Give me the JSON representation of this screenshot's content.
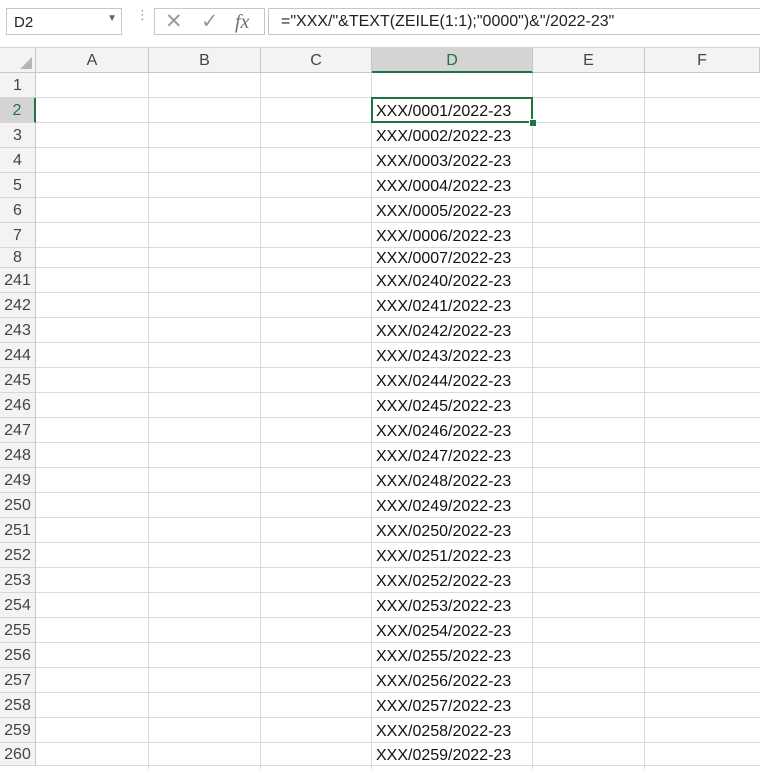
{
  "name_box": {
    "value": "D2"
  },
  "formula_bar": {
    "cancel_icon": "x-icon",
    "enter_icon": "check-icon",
    "fx_label": "fx",
    "formula": "=\"XXX/\"&TEXT(ZEILE(1:1);\"0000\")&\"/2022-23\""
  },
  "columns": [
    "A",
    "B",
    "C",
    "D",
    "E",
    "F"
  ],
  "active_column": "D",
  "active_row": "2",
  "rows": [
    {
      "num": "1",
      "d": ""
    },
    {
      "num": "2",
      "d": "XXX/0001/2022-23"
    },
    {
      "num": "3",
      "d": "XXX/0002/2022-23"
    },
    {
      "num": "4",
      "d": "XXX/0003/2022-23"
    },
    {
      "num": "5",
      "d": "XXX/0004/2022-23"
    },
    {
      "num": "6",
      "d": "XXX/0005/2022-23"
    },
    {
      "num": "7",
      "d": "XXX/0006/2022-23"
    },
    {
      "num": "8",
      "d": "XXX/0007/2022-23"
    },
    {
      "num": "241",
      "d": "XXX/0240/2022-23"
    },
    {
      "num": "242",
      "d": "XXX/0241/2022-23"
    },
    {
      "num": "243",
      "d": "XXX/0242/2022-23"
    },
    {
      "num": "244",
      "d": "XXX/0243/2022-23"
    },
    {
      "num": "245",
      "d": "XXX/0244/2022-23"
    },
    {
      "num": "246",
      "d": "XXX/0245/2022-23"
    },
    {
      "num": "247",
      "d": "XXX/0246/2022-23"
    },
    {
      "num": "248",
      "d": "XXX/0247/2022-23"
    },
    {
      "num": "249",
      "d": "XXX/0248/2022-23"
    },
    {
      "num": "250",
      "d": "XXX/0249/2022-23"
    },
    {
      "num": "251",
      "d": "XXX/0250/2022-23"
    },
    {
      "num": "252",
      "d": "XXX/0251/2022-23"
    },
    {
      "num": "253",
      "d": "XXX/0252/2022-23"
    },
    {
      "num": "254",
      "d": "XXX/0253/2022-23"
    },
    {
      "num": "255",
      "d": "XXX/0254/2022-23"
    },
    {
      "num": "256",
      "d": "XXX/0255/2022-23"
    },
    {
      "num": "257",
      "d": "XXX/0256/2022-23"
    },
    {
      "num": "258",
      "d": "XXX/0257/2022-23"
    },
    {
      "num": "259",
      "d": "XXX/0258/2022-23"
    },
    {
      "num": "260",
      "d": "XXX/0259/2022-23"
    }
  ]
}
